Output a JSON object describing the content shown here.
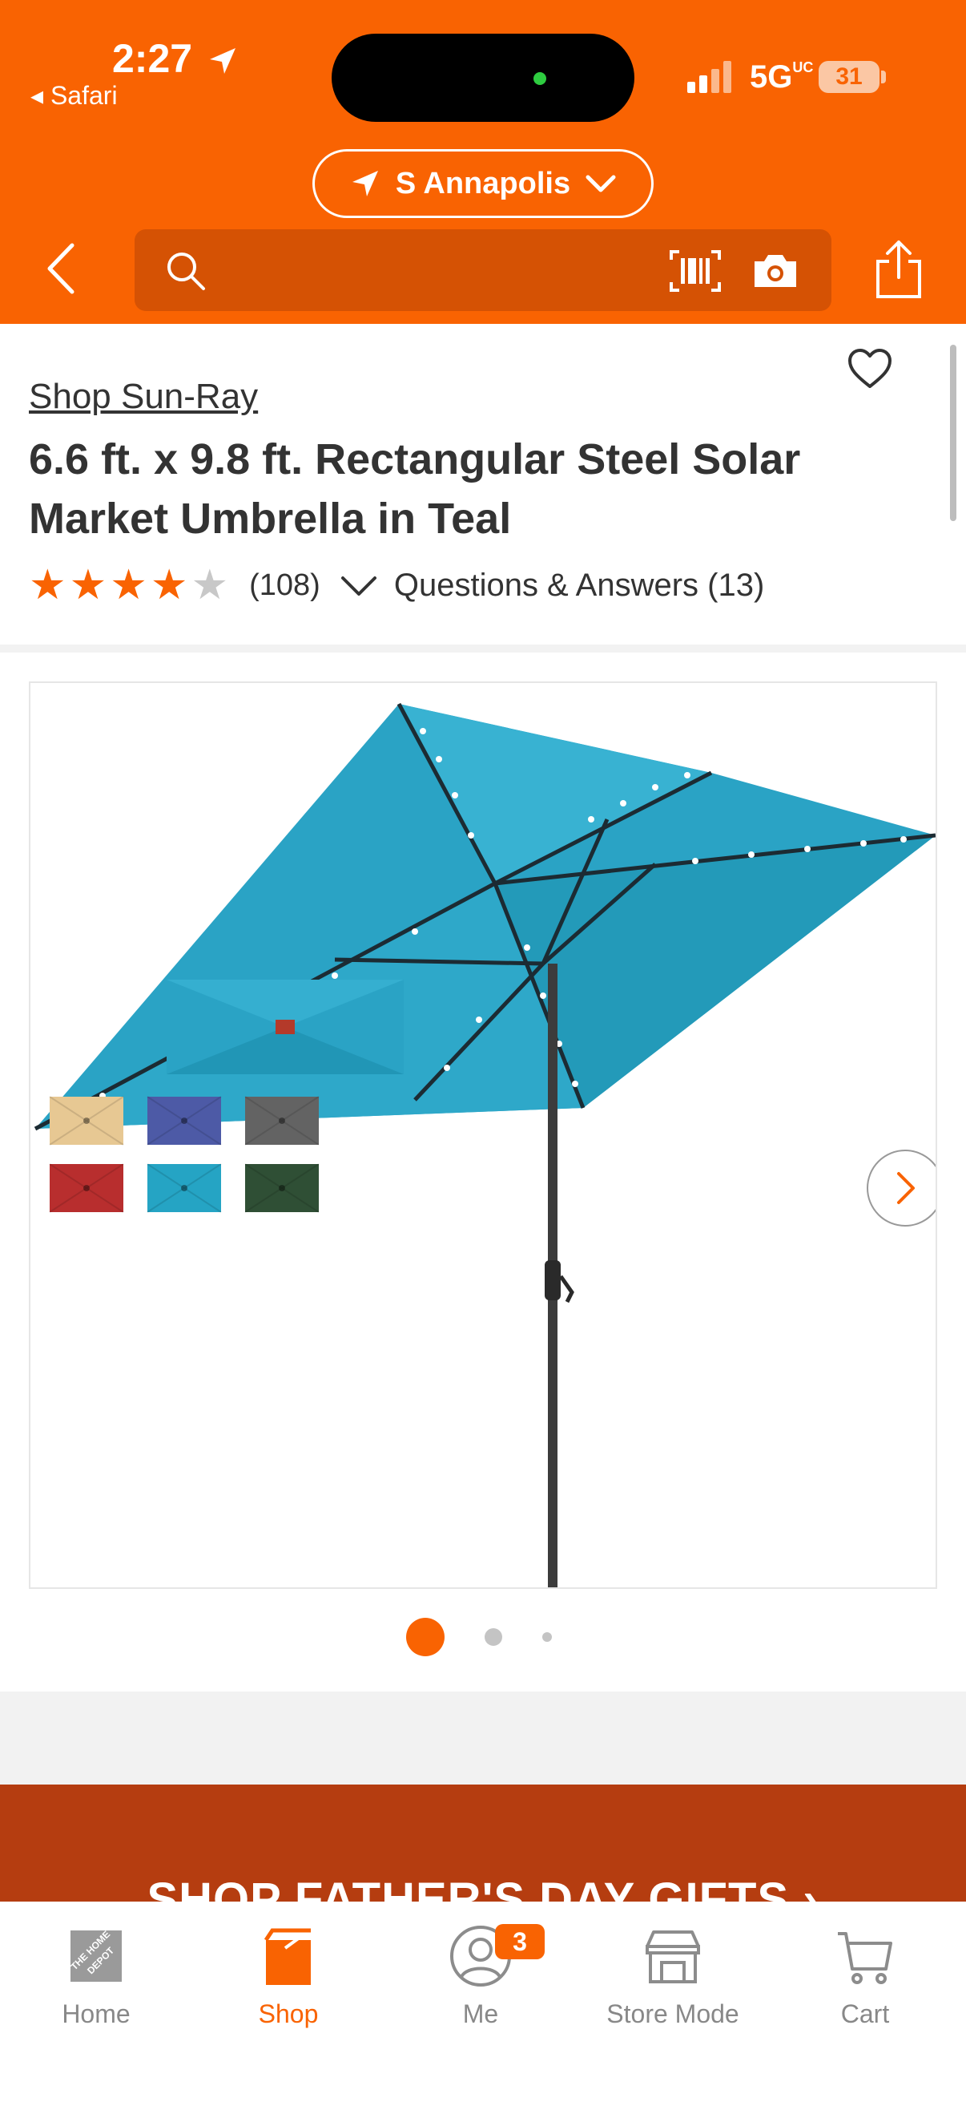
{
  "status_bar": {
    "time": "2:27",
    "back_app": "◂ Safari",
    "network": "5G",
    "network_suffix": "UC",
    "battery": "31"
  },
  "header": {
    "location": "S Annapolis",
    "search_placeholder": "",
    "colors": {
      "brand": "#f96302",
      "search_bg": "#d55204"
    }
  },
  "product": {
    "brand_link": "Shop Sun-Ray",
    "title": "6.6 ft. x 9.8 ft. Rectangular Steel Solar Market Umbrella in Teal",
    "rating": 4,
    "rating_max": 5,
    "review_count": "(108)",
    "qa_label": "Questions & Answers (13)"
  },
  "gallery": {
    "current_index": 1,
    "total_indicators": 3,
    "swatch_colors": [
      "#e7c893",
      "#4d5aa6",
      "#636363",
      "#b82e2e",
      "#25a4c4",
      "#2f4f35"
    ],
    "main_color": "#29a3c6"
  },
  "promo": {
    "label": "SHOP FATHER'S DAY GIFTS ›"
  },
  "bottom_nav": {
    "items": [
      {
        "label": "Home",
        "icon": "home-depot-logo-icon"
      },
      {
        "label": "Shop",
        "icon": "shop-bag-icon"
      },
      {
        "label": "Me",
        "icon": "user-icon",
        "badge": "3"
      },
      {
        "label": "Store Mode",
        "icon": "store-icon"
      },
      {
        "label": "Cart",
        "icon": "cart-icon"
      }
    ],
    "active": "Shop"
  }
}
